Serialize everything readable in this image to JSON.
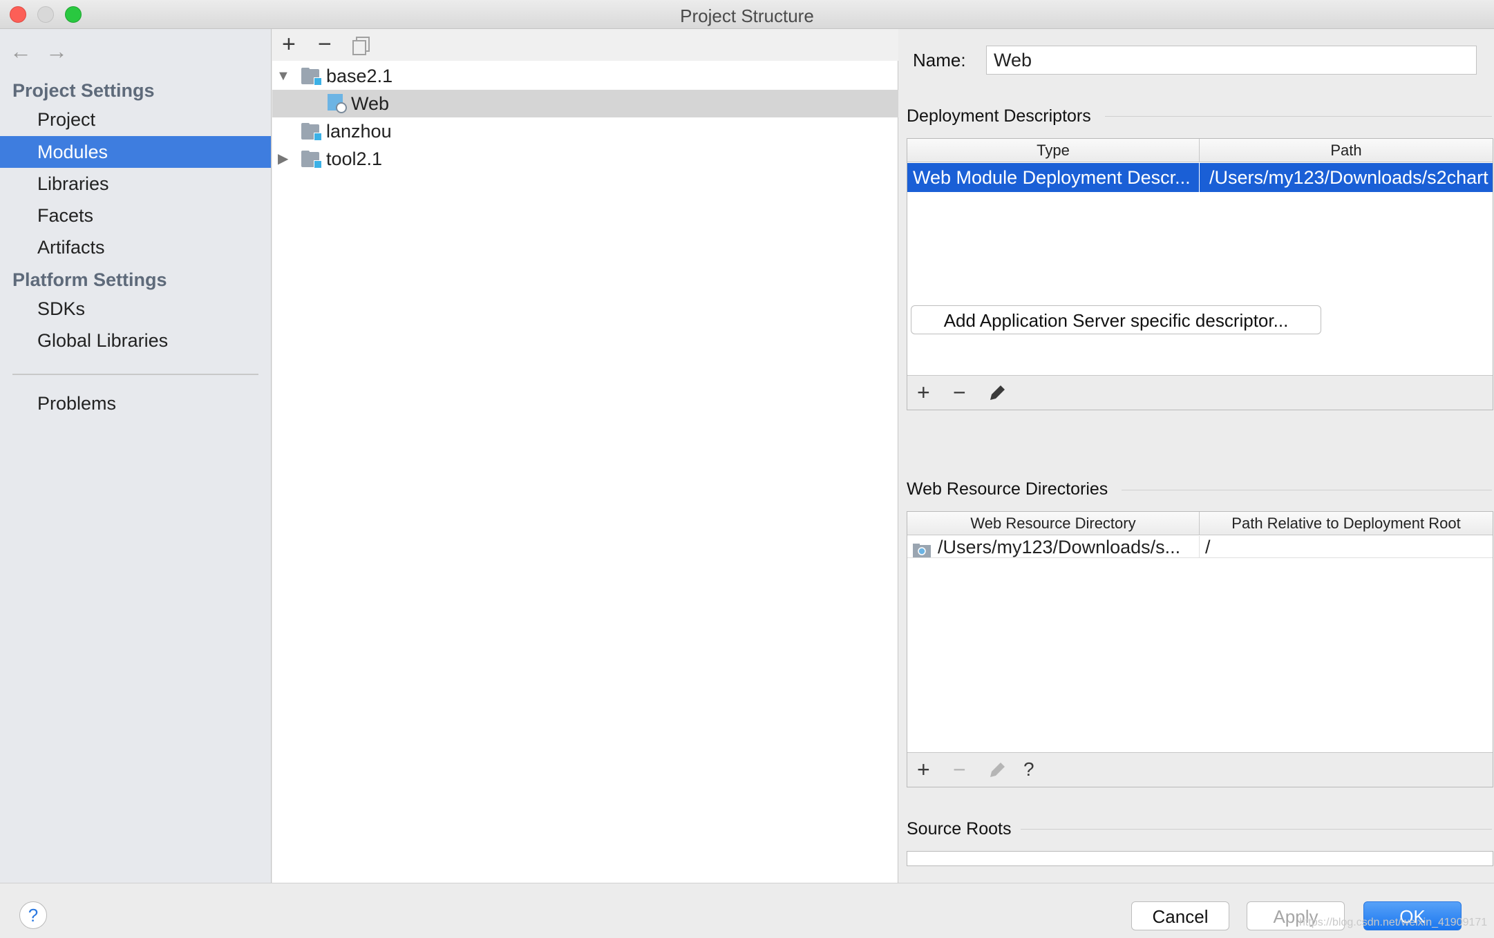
{
  "window": {
    "title": "Project Structure"
  },
  "sidebar": {
    "back_icon": "arrow-left-icon",
    "forward_icon": "arrow-right-icon",
    "project_settings_header": "Project Settings",
    "project_items": [
      {
        "label": "Project"
      },
      {
        "label": "Modules",
        "selected": true
      },
      {
        "label": "Libraries"
      },
      {
        "label": "Facets"
      },
      {
        "label": "Artifacts"
      }
    ],
    "platform_settings_header": "Platform Settings",
    "platform_items": [
      {
        "label": "SDKs"
      },
      {
        "label": "Global Libraries"
      }
    ],
    "problems_label": "Problems"
  },
  "tree": {
    "toolbar": {
      "add": "+",
      "remove": "−",
      "copy_icon": "copy-icon"
    },
    "nodes": [
      {
        "label": "base2.1",
        "expanded": true,
        "icon": "module-folder-icon"
      },
      {
        "label": "Web",
        "selected": true,
        "icon": "web-facet-icon"
      },
      {
        "label": "lanzhou",
        "icon": "module-folder-icon"
      },
      {
        "label": "tool2.1",
        "expanded": false,
        "icon": "module-folder-icon"
      }
    ]
  },
  "details": {
    "name_label": "Name:",
    "name_value": "Web",
    "deployment": {
      "header": "Deployment Descriptors",
      "columns": [
        "Type",
        "Path"
      ],
      "rows": [
        {
          "type": "Web Module Deployment Descr...",
          "path": "/Users/my123/Downloads/s2chart"
        }
      ],
      "tools": {
        "add": "+",
        "remove": "−",
        "edit_icon": "pencil-icon"
      }
    },
    "add_descriptor_button": "Add Application Server specific descriptor...",
    "web_resources": {
      "header": "Web Resource Directories",
      "columns": [
        "Web Resource Directory",
        "Path Relative to Deployment Root"
      ],
      "rows": [
        {
          "directory": "/Users/my123/Downloads/s...",
          "relative": "/"
        }
      ],
      "tools": {
        "add": "+",
        "remove": "−",
        "edit_icon": "pencil-icon",
        "help": "?"
      }
    },
    "source_roots_header": "Source Roots"
  },
  "footer": {
    "help": "?",
    "cancel": "Cancel",
    "apply": "Apply",
    "ok": "OK",
    "watermark": "https://blog.csdn.net/weixin_41909171"
  },
  "colors": {
    "selection_blue": "#3e7ddf",
    "table_selection": "#1a5fd6",
    "close": "#fc5f57",
    "minimize": "#d8d8d8",
    "zoom": "#29c840"
  }
}
